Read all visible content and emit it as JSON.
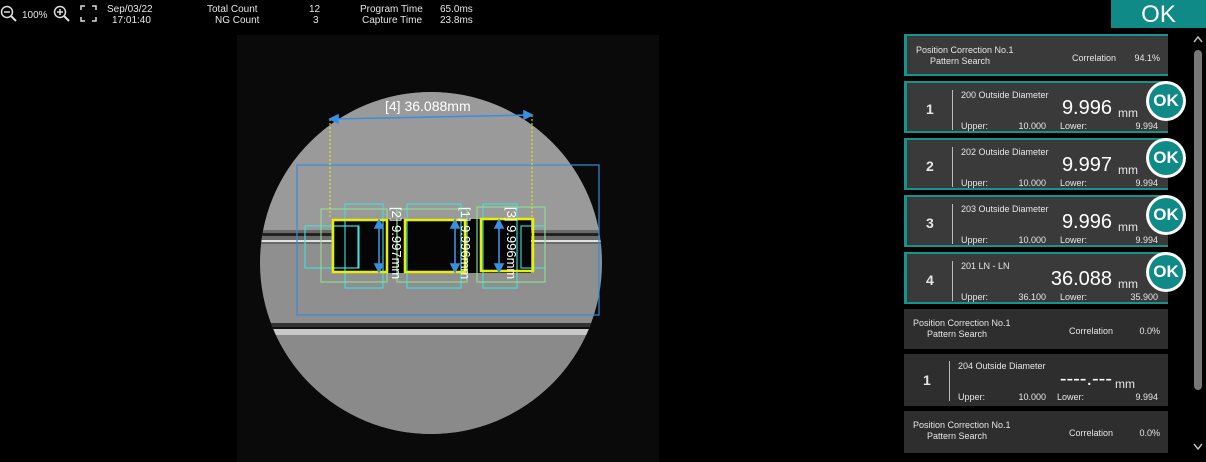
{
  "toolbar": {
    "zoom_level": "100%",
    "date": "Sep/03/22",
    "time": "17:01:40",
    "total_count_label": "Total Count",
    "total_count_value": "12",
    "ng_count_label": "NG Count",
    "ng_count_value": "3",
    "program_time_label": "Program Time",
    "program_time_value": "65.0ms",
    "capture_time_label": "Capture Time",
    "capture_time_value": "23.8ms",
    "overall_result": "OK"
  },
  "viewer": {
    "annotations": {
      "a4": "[4] 36.088mm",
      "a2": "[2] 9.997mm",
      "a1": "[1] 9.996mm",
      "a3": "[3] 9.996mm"
    }
  },
  "panel": {
    "pc1": {
      "title": "Position Correction No.1",
      "sub": "Pattern Search",
      "corr_label": "Correlation",
      "corr_value": "94.1%"
    },
    "m1": {
      "num": "1",
      "name": "200 Outside Diameter",
      "value": "9.996",
      "unit": "mm",
      "upper_label": "Upper:",
      "upper": "10.000",
      "lower_label": "Lower:",
      "lower": "9.994",
      "result": "OK"
    },
    "m2": {
      "num": "2",
      "name": "202 Outside Diameter",
      "value": "9.997",
      "unit": "mm",
      "upper_label": "Upper:",
      "upper": "10.000",
      "lower_label": "Lower:",
      "lower": "9.994",
      "result": "OK"
    },
    "m3": {
      "num": "3",
      "name": "203 Outside Diameter",
      "value": "9.996",
      "unit": "mm",
      "upper_label": "Upper:",
      "upper": "10.000",
      "lower_label": "Lower:",
      "lower": "9.994",
      "result": "OK"
    },
    "m4": {
      "num": "4",
      "name": "201 LN - LN",
      "value": "36.088",
      "unit": "mm",
      "upper_label": "Upper:",
      "upper": "36.100",
      "lower_label": "Lower:",
      "lower": "35.900",
      "result": "OK"
    },
    "pc2": {
      "title": "Position Correction No.1",
      "sub": "Pattern Search",
      "corr_label": "Correlation",
      "corr_value": "0.0%"
    },
    "m5": {
      "num": "1",
      "name": "204 Outside Diameter",
      "value": "----.---",
      "unit": "mm",
      "upper_label": "Upper:",
      "upper": "10.000",
      "lower_label": "Lower:",
      "lower": "9.994"
    },
    "pc3": {
      "title": "Position Correction No.1",
      "sub": "Pattern Search",
      "corr_label": "Correlation",
      "corr_value": "0.0%"
    }
  },
  "colors": {
    "accent": "#0f8a86",
    "panel_bg": "#3a3a3a",
    "measure_arrow": "#3a8fe0",
    "yellow_box": "#e8f000",
    "cyan_box": "#3fe0e0"
  }
}
